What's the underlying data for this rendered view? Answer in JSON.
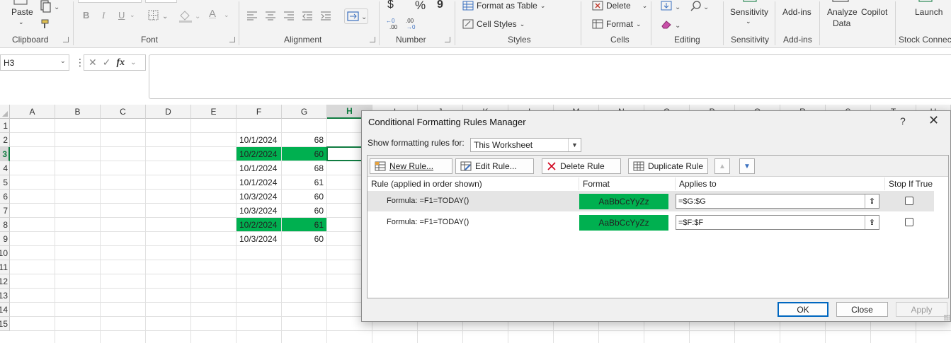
{
  "ribbon": {
    "clipboard": {
      "paste_label": "Paste",
      "group_label": "Clipboard"
    },
    "font": {
      "group_label": "Font",
      "bold": "B",
      "italic": "I",
      "underline": "U",
      "font_color_glyph": "A"
    },
    "alignment": {
      "group_label": "Alignment"
    },
    "number": {
      "group_label": "Number",
      "currency": "$",
      "percent": "%",
      "comma": "9",
      "inc_decimal": "←0 .00",
      "dec_decimal": ".00 →0"
    },
    "styles": {
      "group_label": "Styles",
      "format_as_table": "Format as Table",
      "cell_styles": "Cell Styles"
    },
    "cells": {
      "group_label": "Cells",
      "delete": "Delete",
      "format": "Format"
    },
    "editing": {
      "group_label": "Editing"
    },
    "sensitivity": {
      "label": "Sensitivity",
      "group_label": "Sensitivity"
    },
    "addins": {
      "label": "Add-ins",
      "group_label": "Add-ins"
    },
    "analyze": {
      "label_line1": "Analyze",
      "label_line2": "Data"
    },
    "copilot": {
      "label": "Copilot"
    },
    "launch": {
      "label": "Launch"
    },
    "stock": {
      "group_label": "Stock Connect"
    }
  },
  "formula_bar": {
    "name_box": "H3",
    "fx": "fx",
    "formula": ""
  },
  "grid": {
    "columns": [
      "A",
      "B",
      "C",
      "D",
      "E",
      "F",
      "G",
      "H",
      "I",
      "J",
      "K",
      "L",
      "M",
      "N",
      "O",
      "P",
      "Q",
      "R",
      "S",
      "T",
      "U"
    ],
    "selected_column": "H",
    "rows": [
      "1",
      "2",
      "3",
      "4",
      "5",
      "6",
      "7",
      "8",
      "9",
      "10",
      "11",
      "12",
      "13",
      "14",
      "15"
    ],
    "selected_row": "3",
    "data": [
      {
        "row": "2",
        "f": "10/1/2024",
        "g": "68",
        "highlight": false
      },
      {
        "row": "3",
        "f": "10/2/2024",
        "g": "60",
        "highlight": true
      },
      {
        "row": "4",
        "f": "10/1/2024",
        "g": "68",
        "highlight": false
      },
      {
        "row": "5",
        "f": "10/1/2024",
        "g": "61",
        "highlight": false
      },
      {
        "row": "6",
        "f": "10/3/2024",
        "g": "60",
        "highlight": false
      },
      {
        "row": "7",
        "f": "10/3/2024",
        "g": "60",
        "highlight": false
      },
      {
        "row": "8",
        "f": "10/2/2024",
        "g": "61",
        "highlight": true
      },
      {
        "row": "9",
        "f": "10/3/2024",
        "g": "60",
        "highlight": false
      }
    ],
    "highlight_color": "#00b050",
    "selection_color": "#107c41"
  },
  "dialog": {
    "title": "Conditional Formatting Rules Manager",
    "help": "?",
    "close": "✕",
    "show_rules_label": "Show formatting rules for:",
    "show_rules_value": "This Worksheet",
    "buttons": {
      "new_rule": "New Rule...",
      "edit_rule": "Edit Rule...",
      "delete_rule": "Delete Rule",
      "duplicate_rule": "Duplicate Rule"
    },
    "columns": {
      "rule": "Rule (applied in order shown)",
      "format": "Format",
      "applies_to": "Applies to",
      "stop_if_true": "Stop If True"
    },
    "rules": [
      {
        "rule": "Formula: =F1=TODAY()",
        "preview": "AaBbCcYyZz",
        "applies_to": "=$G:$G",
        "stop_if_true": false,
        "selected": true
      },
      {
        "rule": "Formula: =F1=TODAY()",
        "preview": "AaBbCcYyZz",
        "applies_to": "=$F:$F",
        "stop_if_true": false,
        "selected": false
      }
    ],
    "ok": "OK",
    "close_btn": "Close",
    "apply": "Apply"
  }
}
